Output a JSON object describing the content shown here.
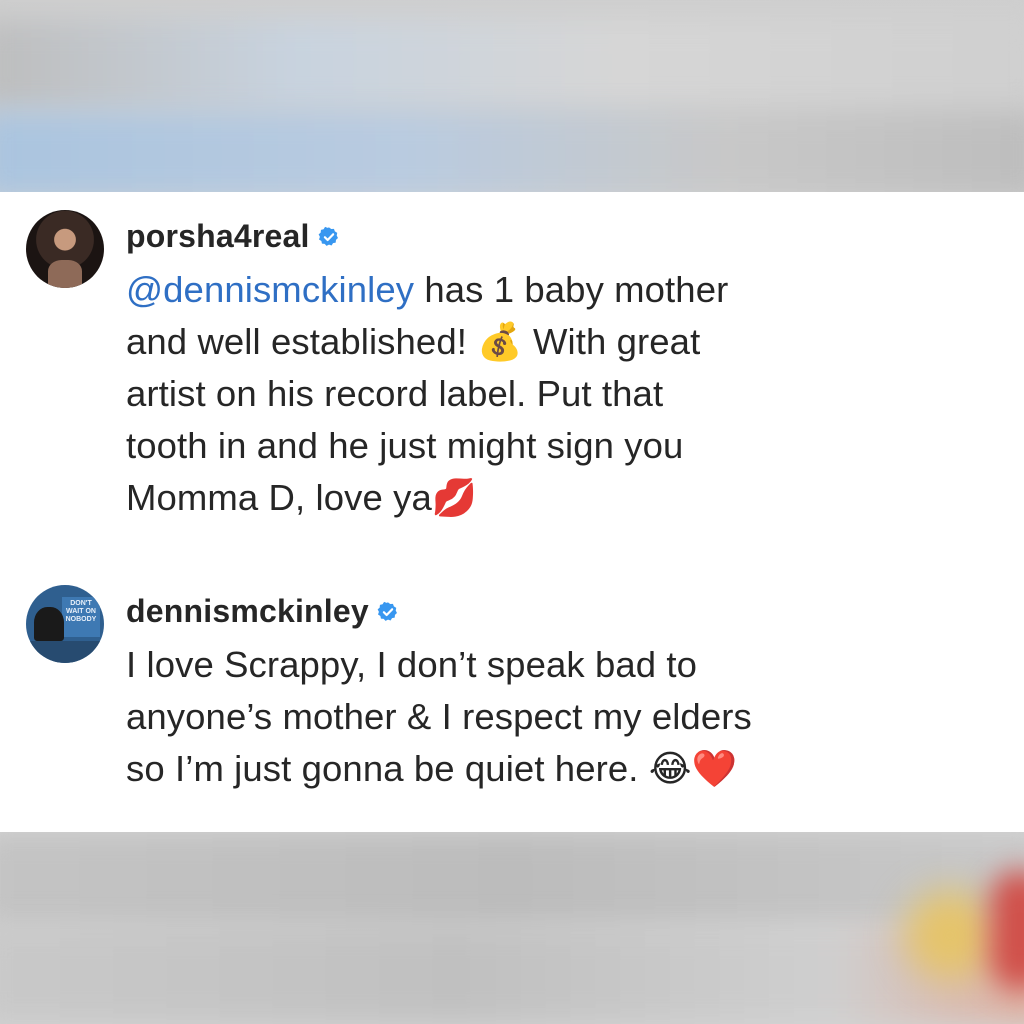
{
  "comments": [
    {
      "username": "porsha4real",
      "verified": true,
      "mention": "@dennismckinley",
      "lines": [
        " has 1 baby mother",
        "and well established! 💰 With great",
        "artist on his record label. Put that",
        "tooth in and he just might sign you",
        "Momma D, love ya💋"
      ]
    },
    {
      "username": "dennismckinley",
      "verified": true,
      "avatar_sign_text": "DON'T WAIT ON NOBODY",
      "lines": [
        "I love Scrappy, I don’t speak bad to",
        "anyone’s mother & I respect my elders",
        "so I’m just gonna be quiet here. 😂❤️"
      ]
    }
  ],
  "colors": {
    "mention": "#2f6fc4",
    "verified_badge": "#3897f0",
    "text": "#262626",
    "card_background": "#ffffff"
  },
  "icons": {
    "verified": "verified-badge-icon"
  }
}
